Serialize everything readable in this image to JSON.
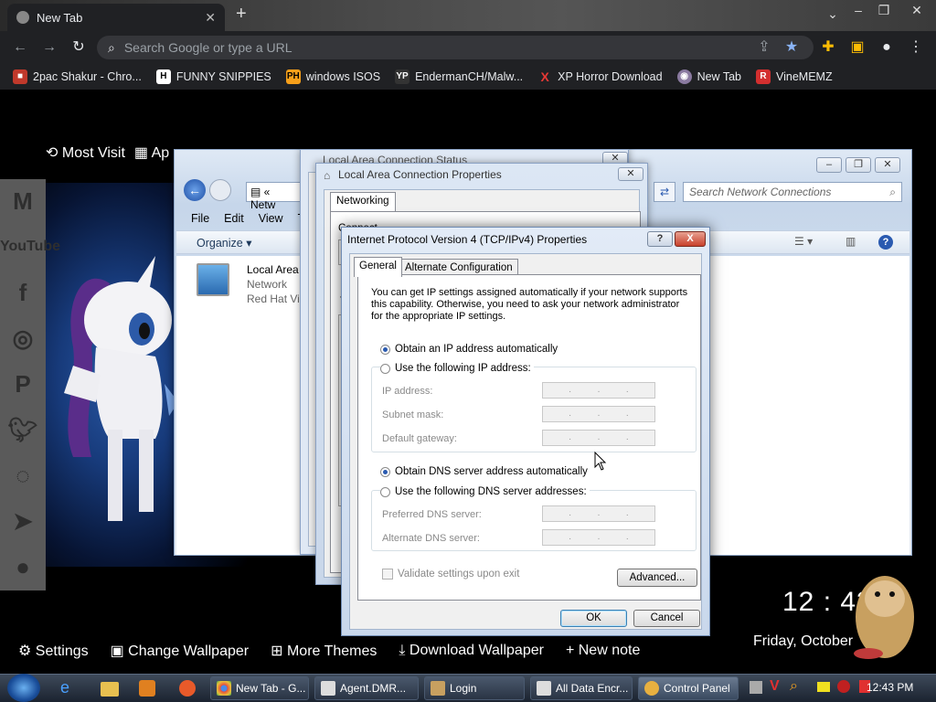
{
  "browser": {
    "tab_title": "New Tab",
    "omnibox_placeholder": "Search Google or type a URL",
    "bookmarks": [
      {
        "label": "2pac Shakur - Chro...",
        "icon": "gift-icon"
      },
      {
        "label": "FUNNY SNIPPIES",
        "icon": "h-icon"
      },
      {
        "label": "windows ISOS",
        "icon": "ph-icon"
      },
      {
        "label": "EndermanCH/Malw...",
        "icon": "yp-icon"
      },
      {
        "label": "XP Horror Download",
        "icon": "x-icon"
      },
      {
        "label": "New Tab",
        "icon": "globe-icon"
      },
      {
        "label": "VineMEMZ",
        "icon": "r-icon"
      }
    ]
  },
  "newtab": {
    "most_visited": "Most Visit",
    "apps": "Ap",
    "search_google": "Search Google",
    "bottom_links": [
      "Settings",
      "Change Wallpaper",
      "More Themes",
      "Download Wallpaper",
      "+ New note"
    ],
    "clock": "12 : 43",
    "date": "Friday, October",
    "social": [
      "gmail",
      "YouTube",
      "facebook",
      "instagram",
      "pinterest",
      "twitter",
      "whatsapp",
      "telegram",
      "reddit"
    ]
  },
  "explorer": {
    "address_crumb": "Netw",
    "search_placeholder": "Search Network Connections",
    "menu": [
      "File",
      "Edit",
      "View",
      "To"
    ],
    "organize": "Organize",
    "item": {
      "name": "Local Area",
      "line2": "Network",
      "line3": "Red Hat Vir"
    }
  },
  "status_window": {
    "title": "Local Area Connection Status"
  },
  "props_window": {
    "title": "Local Area Connection Properties",
    "tab": "Networking",
    "partial_label": "Connect",
    "t_label": "T"
  },
  "ipv4": {
    "title": "Internet Protocol Version 4 (TCP/IPv4) Properties",
    "tabs": [
      "General",
      "Alternate Configuration"
    ],
    "description": [
      "You can get IP settings assigned automatically if your network supports",
      "this capability. Otherwise, you need to ask your network administrator",
      "for the appropriate IP settings."
    ],
    "ip_auto": "Obtain an IP address automatically",
    "ip_manual": "Use the following IP address:",
    "ip_address": "IP address:",
    "subnet_mask": "Subnet mask:",
    "default_gateway": "Default gateway:",
    "dns_auto": "Obtain DNS server address automatically",
    "dns_manual": "Use the following DNS server addresses:",
    "preferred_dns": "Preferred DNS server:",
    "alternate_dns": "Alternate DNS server:",
    "validate": "Validate settings upon exit",
    "advanced": "Advanced...",
    "ok": "OK",
    "cancel": "Cancel",
    "help": "?",
    "close": "X"
  },
  "taskbar": {
    "items": [
      "New Tab - G...",
      "Agent.DMR...",
      "Login",
      "All Data Encr...",
      "Control Panel"
    ],
    "time": "12:43 PM"
  },
  "colors": {
    "chrome_bg": "#202124",
    "win7_title": "#c9d8ec",
    "close_red": "#c8412b"
  }
}
